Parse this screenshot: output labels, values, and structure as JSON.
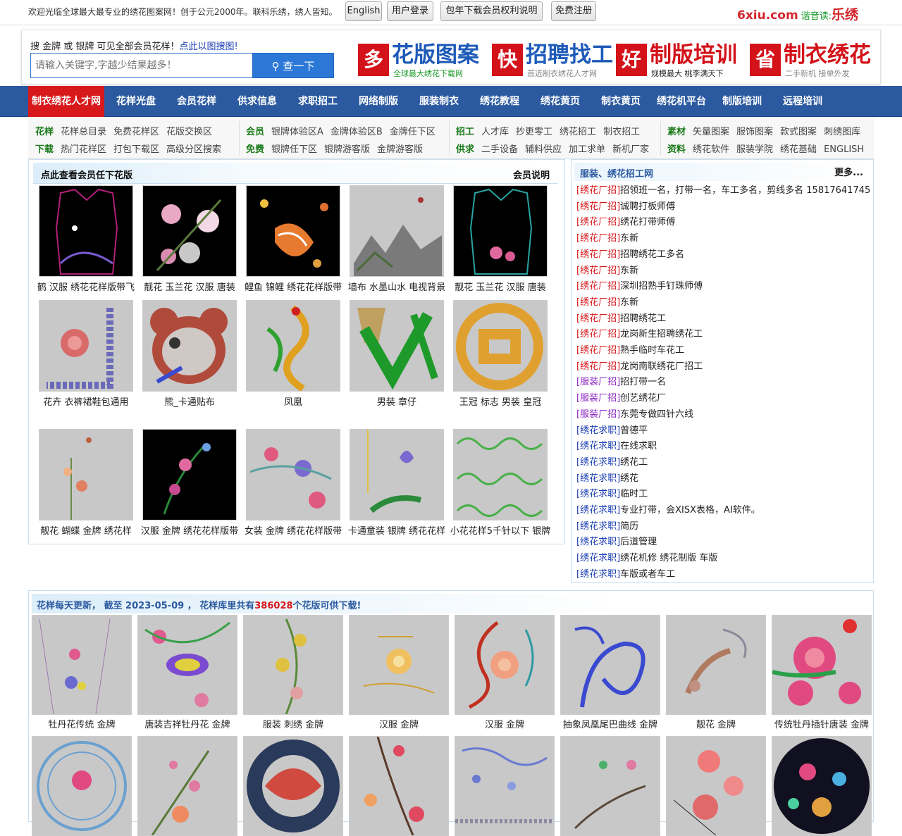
{
  "topbar": {
    "welcome": "欢迎光临全球最大最专业的绣花图案网！创于公元2000年。联科乐绣，绣人皆知。",
    "buttons": [
      "English",
      "用户登录",
      "包年下载会员权利说明",
      "免费注册"
    ],
    "logo": {
      "main": "6xiu.com",
      "sub": "谐音读:",
      "brush": "乐绣"
    }
  },
  "search": {
    "hint": "搜 金牌 或 银牌 可见全部会员花样！",
    "hint_link": "点此以图搜图!",
    "placeholder": "请输入关键字,字越少结果越多！",
    "button": "查一下"
  },
  "ads": [
    {
      "big": "多",
      "title": "花版图案",
      "sub": "全球最大绣花下载网",
      "color": "#1e5bb8",
      "subcolor": "#1a9a2a"
    },
    {
      "big": "快",
      "title": "招聘找工",
      "sub": "首选制衣绣花人才网",
      "color": "#1e5bb8",
      "subcolor": "#888888"
    },
    {
      "big": "好",
      "title": "制版培训",
      "sub": "规模最大  桃李满天下",
      "color": "#d3121a",
      "subcolor": "#222222"
    },
    {
      "big": "省",
      "title": "制衣绣花",
      "sub": "二手新机 接单外发",
      "color": "#d3121a",
      "subcolor": "#888888"
    }
  ],
  "nav": [
    "制衣绣花人才网",
    "花样光盘",
    "会员花样",
    "供求信息",
    "求职招工",
    "网络制版",
    "服装制衣",
    "绣花教程",
    "绣花黄页",
    "制衣黄页",
    "绣花机平台",
    "制版培训",
    "远程培训"
  ],
  "subnav": [
    {
      "k1": "花样",
      "l1": [
        "花样总目录",
        "免费花样区",
        "花版交换区"
      ],
      "k2": "下载",
      "l2": [
        "热门花样区",
        "打包下载区",
        "高级分区搜索"
      ]
    },
    {
      "k1": "会员",
      "l1": [
        "银牌体验区A",
        "金牌体验区B",
        "金牌任下区"
      ],
      "k2": "免费",
      "l2": [
        "银牌任下区",
        "银牌游客版",
        "金牌游客版"
      ]
    },
    {
      "k1": "招工",
      "l1": [
        "人才库",
        "抄更零工",
        "绣花招工",
        "制衣招工"
      ],
      "k2": "供求",
      "l2": [
        "二手设备",
        "辅料供应",
        "加工求单",
        "新机厂家"
      ]
    },
    {
      "k1": "素材",
      "l1": [
        "矢量图案",
        "服饰图案",
        "款式图案",
        "刺绣图库"
      ],
      "k2": "资料",
      "l2": [
        "绣花软件",
        "服装学院",
        "绣花基础",
        "ENGLISH"
      ]
    }
  ],
  "vip": {
    "title": "点此查看会员任下花版",
    "link": "会员说明",
    "items": [
      {
        "caption": "鹤 汉服 绣花花样版带飞",
        "bg": "#000000",
        "motif": "vest"
      },
      {
        "caption": "靓花 玉兰花 汉服 唐装",
        "bg": "#000000",
        "motif": "flowers"
      },
      {
        "caption": "鲤鱼 锦鲤 绣花花样版带",
        "bg": "#000000",
        "motif": "koi"
      },
      {
        "caption": "墙布 水墨山水 电视背景",
        "bg": "#c8c8c8",
        "motif": "landscape"
      },
      {
        "caption": "靓花 玉兰花 汉服 唐装",
        "bg": "#000000",
        "motif": "vest2"
      },
      {
        "caption": "花卉 衣裤裙鞋包通用",
        "bg": "#c8c8c8",
        "motif": "rose"
      },
      {
        "caption": "熊_卡通贴布",
        "bg": "#c8c8c8",
        "motif": "bear"
      },
      {
        "caption": "凤凰",
        "bg": "#c8c8c8",
        "motif": "phoenix"
      },
      {
        "caption": "男装 章仔",
        "bg": "#c8c8c8",
        "motif": "badge"
      },
      {
        "caption": "王冠 标志 男装 皇冠",
        "bg": "#c8c8c8",
        "motif": "crown"
      },
      {
        "caption": "靓花 蝴蝶 金牌 绣花样",
        "bg": "#c8c8c8",
        "motif": "butterfly"
      },
      {
        "caption": "汉服 金牌 绣花花样版带",
        "bg": "#000000",
        "motif": "vine"
      },
      {
        "caption": "女装 金牌 绣花花样版带",
        "bg": "#c8c8c8",
        "motif": "swirl"
      },
      {
        "caption": "卡通童装 银牌 绣花花样",
        "bg": "#c8c8c8",
        "motif": "bird"
      },
      {
        "caption": "小花花样5千针以下 银牌",
        "bg": "#c8c8c8",
        "motif": "lace"
      }
    ]
  },
  "jobs": {
    "title": "服装、绣花招工网",
    "more": "更多...",
    "items": [
      {
        "tag": "[绣花厂招]",
        "type": "f",
        "text": "招领班一名，打带一名，车工多名，剪线多名 15817641745"
      },
      {
        "tag": "[绣花厂招]",
        "type": "f",
        "text": "诚聘打板师傅"
      },
      {
        "tag": "[绣花厂招]",
        "type": "f",
        "text": "绣花打带师傅"
      },
      {
        "tag": "[绣花厂招]",
        "type": "f",
        "text": "东新"
      },
      {
        "tag": "[绣花厂招]",
        "type": "f",
        "text": "招聘绣花工多名"
      },
      {
        "tag": "[绣花厂招]",
        "type": "f",
        "text": "东新"
      },
      {
        "tag": "[绣花厂招]",
        "type": "f",
        "text": "深圳招熟手钉珠师傅"
      },
      {
        "tag": "[绣花厂招]",
        "type": "f",
        "text": "东新"
      },
      {
        "tag": "[绣花厂招]",
        "type": "f",
        "text": "招聘绣花工"
      },
      {
        "tag": "[绣花厂招]",
        "type": "f",
        "text": "龙岗新生招聘绣花工"
      },
      {
        "tag": "[绣花厂招]",
        "type": "f",
        "text": "熟手临时车花工"
      },
      {
        "tag": "[绣花厂招]",
        "type": "f",
        "text": "龙岗南联绣花厂招工"
      },
      {
        "tag": "[服装厂招]",
        "type": "c",
        "text": "招打带一名"
      },
      {
        "tag": "[服装厂招]",
        "type": "c",
        "text": "创艺绣花厂"
      },
      {
        "tag": "[服装厂招]",
        "type": "c",
        "text": "东莞专做四针六线"
      },
      {
        "tag": "[绣花求职]",
        "type": "q",
        "text": "曾德平"
      },
      {
        "tag": "[绣花求职]",
        "type": "q",
        "text": "在线求职"
      },
      {
        "tag": "[绣花求职]",
        "type": "q",
        "text": "绣花工"
      },
      {
        "tag": "[绣花求职]",
        "type": "q",
        "text": "绣花"
      },
      {
        "tag": "[绣花求职]",
        "type": "q",
        "text": "临时工"
      },
      {
        "tag": "[绣花求职]",
        "type": "q",
        "text": "专业打带，会XISX表格，AI软件。"
      },
      {
        "tag": "[绣花求职]",
        "type": "q",
        "text": "简历"
      },
      {
        "tag": "[绣花求职]",
        "type": "q",
        "text": "后道管理"
      },
      {
        "tag": "[绣花求职]",
        "type": "q",
        "text": "绣花机修 绣花制版 车版"
      },
      {
        "tag": "[绣花求职]",
        "type": "q",
        "text": "车版或者车工"
      }
    ]
  },
  "latest": {
    "prefix": "花样每天更新， 截至 2023-05-09 ， 花样库里共有",
    "count": "386028",
    "suffix": "个花版可供下载!",
    "items": [
      {
        "caption": "牡丹花传统 金牌",
        "motif": "smallflower"
      },
      {
        "caption": "唐装吉祥牡丹花 金牌",
        "motif": "peony"
      },
      {
        "caption": "服装 刺绣 金牌",
        "motif": "vinev"
      },
      {
        "caption": "汉服 金牌",
        "motif": "chrys"
      },
      {
        "caption": "汉服 金牌",
        "motif": "rosered"
      },
      {
        "caption": "抽象凤凰尾巴曲线 金牌",
        "motif": "bluephoenix"
      },
      {
        "caption": "靓花 金牌",
        "motif": "koigray"
      },
      {
        "caption": "传统牡丹插针唐装 金牌",
        "motif": "bigpeony"
      },
      {
        "caption": "",
        "motif": "circle"
      },
      {
        "caption": "",
        "motif": "plum"
      },
      {
        "caption": "",
        "motif": "mask"
      },
      {
        "caption": "",
        "motif": "plum2"
      },
      {
        "caption": "",
        "motif": "pattern"
      },
      {
        "caption": "",
        "motif": "hummer"
      },
      {
        "caption": "",
        "motif": "rose2"
      },
      {
        "caption": "",
        "motif": "circleblack"
      }
    ]
  }
}
